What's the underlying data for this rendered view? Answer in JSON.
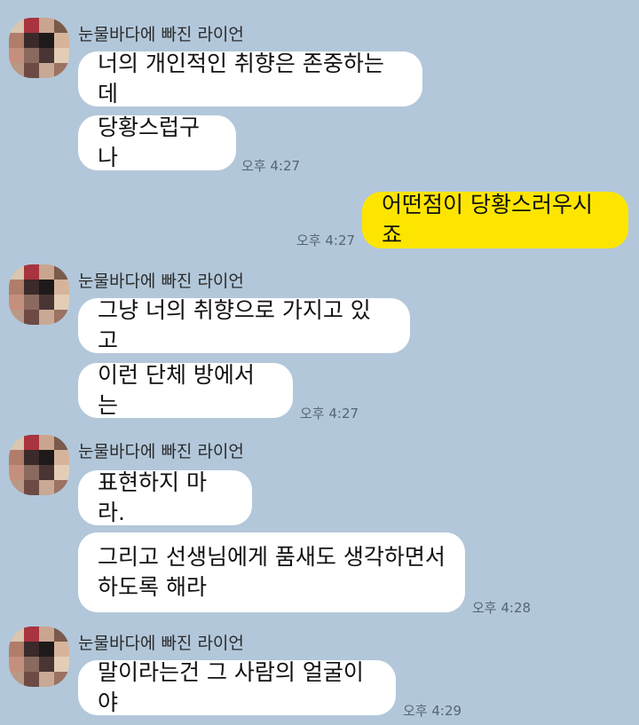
{
  "sender_name": "눈물바다에 빠진 라이언",
  "colors": {
    "background": "#b2c7da",
    "bubble_received": "#ffffff",
    "bubble_sent": "#fee500",
    "timestamp": "#556677"
  },
  "messages": [
    {
      "id": "m1",
      "side": "received",
      "text": "너의 개인적인 취향은 존중하는데"
    },
    {
      "id": "m2",
      "side": "received",
      "text": "당황스럽구나",
      "time": "오후 4:27"
    },
    {
      "id": "m3",
      "side": "sent",
      "text": "어떤점이 당황스러우시죠",
      "time": "오후 4:27"
    },
    {
      "id": "m4",
      "side": "received",
      "text": "그냥 너의 취향으로 가지고 있고"
    },
    {
      "id": "m5",
      "side": "received",
      "text": "이런 단체 방에서는",
      "time": "오후 4:27"
    },
    {
      "id": "m6",
      "side": "received",
      "text": "표현하지 마라."
    },
    {
      "id": "m7",
      "side": "received",
      "text": "그리고 선생님에게 품새도 생각하면서\n하도록 해라",
      "time": "오후 4:28"
    },
    {
      "id": "m8",
      "side": "received",
      "text": "말이라는건 그 사람의 얼굴이야",
      "time": "오후 4:29"
    }
  ]
}
